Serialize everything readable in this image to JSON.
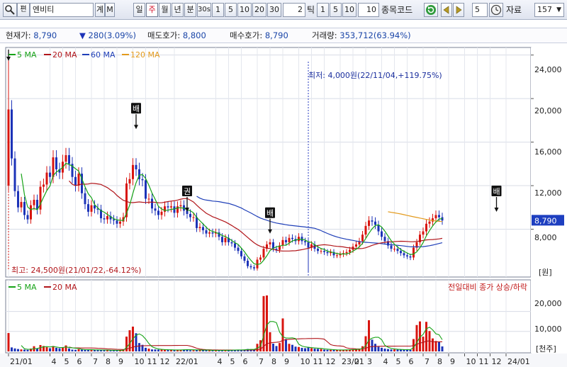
{
  "toolbar": {
    "search_icon": "search-icon",
    "flag_label": "편",
    "stock_name": "엔비티",
    "btn_gye": "계",
    "btn_m": "M",
    "period_buttons": [
      "일",
      "주",
      "월",
      "년",
      "분",
      "30s",
      "1",
      "5",
      "10",
      "20",
      "30"
    ],
    "period_selected": "주",
    "count_value": "2",
    "tick_label": "틱",
    "tick_buttons": [
      "1",
      "5",
      "10"
    ],
    "tick_count": "10",
    "code_label": "종목코드",
    "step_value": "5",
    "data_label": "자료",
    "data_count": "157"
  },
  "info": {
    "price_label": "현재가:",
    "price": "8,790",
    "change_arrow": "▼",
    "change": "280(3.09%)",
    "ask_label": "매도호가:",
    "ask": "8,800",
    "bid_label": "매수호가:",
    "bid": "8,790",
    "vol_label": "거래량:",
    "volume": "353,712(63.94%)"
  },
  "colors": {
    "up": "#d8150f",
    "down": "#1c33b8",
    "ma5": "#17a317",
    "ma20": "#b1151a",
    "ma60": "#1f3fb8",
    "ma120": "#e39a1c",
    "accent": "#1b46a8"
  },
  "chart_data": {
    "type": "candlestick",
    "price_legend": [
      {
        "name": "5 MA",
        "color": "#17a317"
      },
      {
        "name": "20 MA",
        "color": "#b1151a"
      },
      {
        "name": "60 MA",
        "color": "#1f3fb8"
      },
      {
        "name": "120 MA",
        "color": "#e39a1c"
      }
    ],
    "volume_legend": [
      {
        "name": "5 MA",
        "color": "#17a317"
      },
      {
        "name": "20 MA",
        "color": "#b1151a"
      }
    ],
    "volume_legend_right": "전일대비 종가 상승/하락",
    "price_ticks": [
      "24,000",
      "20,000",
      "16,000",
      "12,000",
      "8,000"
    ],
    "price_tick_values": [
      24000,
      20000,
      16000,
      12000,
      8000
    ],
    "ylim_price": [
      3800,
      24500
    ],
    "price_unit": "[원]",
    "volume_ticks": [
      "20,000",
      "10,000"
    ],
    "volume_tick_values": [
      20000,
      10000
    ],
    "ylim_volume": [
      0,
      28000
    ],
    "volume_unit": "[천주]",
    "current_price": 8790,
    "current_price_label": "8,790",
    "annotation_low": "최저: 4,000원(22/11/04,+119.75%)",
    "annotation_high": "최고: 24,500원(21/01/22,-64.12%)",
    "markers": [
      {
        "label": "배",
        "week": 40,
        "price": 17000
      },
      {
        "label": "권",
        "week": 56,
        "price": 9400
      },
      {
        "label": "배",
        "week": 82,
        "price": 7400
      },
      {
        "label": "배",
        "week": 153,
        "price": 9400
      }
    ],
    "x_tick_labels": [
      {
        "week": 0,
        "label": "21/01"
      },
      {
        "week": 13,
        "label": "4"
      },
      {
        "week": 17,
        "label": "5"
      },
      {
        "week": 21,
        "label": "6"
      },
      {
        "week": 26,
        "label": "7"
      },
      {
        "week": 30,
        "label": "8"
      },
      {
        "week": 34,
        "label": "9"
      },
      {
        "week": 39,
        "label": "10"
      },
      {
        "week": 43,
        "label": "11"
      },
      {
        "week": 47,
        "label": "12"
      },
      {
        "week": 52,
        "label": "22/01"
      },
      {
        "week": 65,
        "label": "4"
      },
      {
        "week": 69,
        "label": "5"
      },
      {
        "week": 73,
        "label": "6"
      },
      {
        "week": 78,
        "label": "7"
      },
      {
        "week": 82,
        "label": "8"
      },
      {
        "week": 86,
        "label": "9"
      },
      {
        "week": 91,
        "label": "10"
      },
      {
        "week": 95,
        "label": "11"
      },
      {
        "week": 99,
        "label": "12"
      },
      {
        "week": 104,
        "label": "23/01"
      },
      {
        "week": 108,
        "label": "2"
      },
      {
        "week": 112,
        "label": "3"
      },
      {
        "week": 117,
        "label": "4"
      },
      {
        "week": 121,
        "label": "5"
      },
      {
        "week": 125,
        "label": "6"
      },
      {
        "week": 130,
        "label": "7"
      },
      {
        "week": 134,
        "label": "8"
      },
      {
        "week": 138,
        "label": "9"
      },
      {
        "week": 143,
        "label": "10"
      },
      {
        "week": 147,
        "label": "11"
      },
      {
        "week": 151,
        "label": "12"
      },
      {
        "week": 156,
        "label": "24/01"
      }
    ],
    "close": [
      19000,
      14500,
      11500,
      10000,
      10500,
      9300,
      8900,
      10200,
      10700,
      9800,
      11900,
      12100,
      13200,
      12800,
      14600,
      13500,
      13200,
      14200,
      14800,
      14000,
      12800,
      12000,
      13100,
      11300,
      10300,
      9600,
      10200,
      9900,
      9800,
      9000,
      8900,
      9200,
      8900,
      8800,
      8500,
      8700,
      9100,
      12200,
      12600,
      13900,
      13500,
      12600,
      12500,
      10800,
      10800,
      9900,
      9700,
      9300,
      9600,
      10100,
      10000,
      10100,
      9500,
      10100,
      10200,
      9700,
      9400,
      9100,
      9100,
      8100,
      8200,
      7900,
      7600,
      7700,
      7600,
      7700,
      7300,
      6800,
      7200,
      6800,
      6700,
      6300,
      6000,
      5500,
      5100,
      4600,
      4500,
      4400,
      5200,
      5400,
      6200,
      6600,
      6800,
      6200,
      6100,
      6500,
      7000,
      6800,
      7200,
      7100,
      6900,
      7300,
      6900,
      6800,
      6300,
      6600,
      6200,
      6000,
      6000,
      5900,
      5800,
      5900,
      5600,
      5600,
      5700,
      5800,
      5900,
      6100,
      6400,
      6600,
      6900,
      7500,
      8300,
      8800,
      8700,
      8400,
      7800,
      7300,
      6900,
      6500,
      6200,
      6200,
      6000,
      5800,
      5600,
      5500,
      5400,
      6300,
      6800,
      7500,
      7800,
      8500,
      8700,
      9000,
      9300,
      9100,
      8800
    ],
    "volume": [
      9200,
      2000,
      1500,
      1200,
      1000,
      900,
      800,
      1400,
      2600,
      1500,
      3200,
      2700,
      2100,
      1600,
      2700,
      1800,
      1600,
      2000,
      3000,
      1500,
      900,
      800,
      1100,
      900,
      800,
      700,
      900,
      700,
      800,
      600,
      600,
      600,
      500,
      500,
      500,
      500,
      900,
      7400,
      10600,
      12400,
      9100,
      4200,
      3300,
      1800,
      1400,
      1000,
      1000,
      900,
      900,
      800,
      700,
      700,
      700,
      800,
      900,
      900,
      1000,
      600,
      600,
      800,
      700,
      600,
      600,
      500,
      500,
      500,
      500,
      600,
      700,
      600,
      700,
      800,
      900,
      800,
      900,
      1200,
      1100,
      1000,
      3800,
      5600,
      27700,
      28000,
      9600,
      3900,
      2700,
      4200,
      16500,
      6200,
      3800,
      3300,
      2400,
      2200,
      1800,
      1600,
      2200,
      1600,
      1400,
      1300,
      1200,
      900,
      800,
      800,
      700,
      700,
      800,
      800,
      900,
      900,
      1100,
      1200,
      1400,
      2600,
      7600,
      15600,
      5900,
      3800,
      2300,
      1800,
      1400,
      1200,
      1000,
      1000,
      900,
      900,
      800,
      800,
      800,
      6200,
      13200,
      15000,
      7400,
      14800,
      10200,
      6500,
      5200,
      4900,
      2500
    ],
    "ma120": [
      null,
      null,
      null,
      null,
      null,
      null,
      null,
      null,
      null,
      null,
      null,
      null,
      null,
      null,
      null,
      null,
      null,
      null,
      null,
      null,
      null,
      null,
      null,
      null,
      null,
      null,
      null,
      null,
      null,
      null,
      null,
      null,
      null,
      null,
      null,
      null,
      null,
      null,
      null,
      null,
      null,
      null,
      null,
      null,
      null,
      null,
      null,
      null,
      null,
      null,
      null,
      null,
      null,
      null,
      null,
      null,
      null,
      null,
      null,
      null,
      null,
      null,
      null,
      null,
      null,
      null,
      null,
      null,
      null,
      null,
      null,
      null,
      null,
      null,
      null,
      null,
      null,
      null,
      null,
      null,
      null,
      null,
      null,
      null,
      null,
      null,
      null,
      null,
      null,
      null,
      null,
      null,
      null,
      null,
      null,
      null,
      null,
      null,
      null,
      null,
      null,
      null,
      null,
      null,
      null,
      null,
      null,
      null,
      null,
      null,
      null,
      null,
      null,
      null,
      null,
      null,
      null,
      null,
      null,
      9600,
      9550,
      9500,
      9450,
      9400,
      9330,
      9260,
      9200,
      9140,
      9080,
      9020,
      8960,
      8900,
      8840,
      8790,
      8750,
      8720,
      8700
    ]
  }
}
